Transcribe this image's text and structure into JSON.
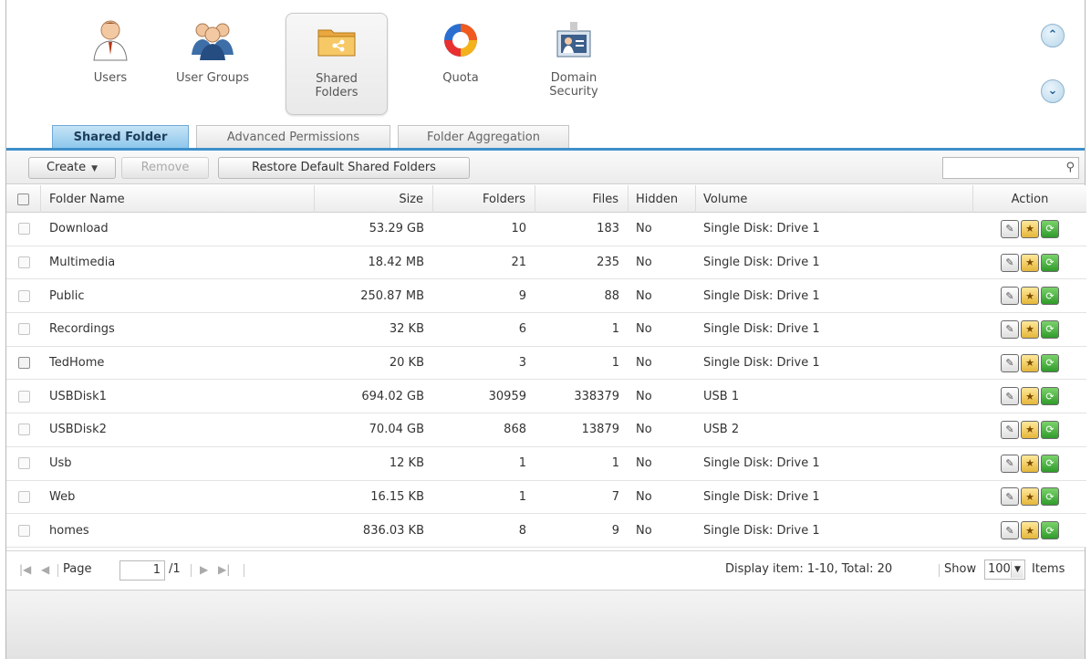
{
  "apps": [
    {
      "label": "Users",
      "icon": "user-icon"
    },
    {
      "label": "User Groups",
      "icon": "user-groups-icon"
    },
    {
      "label": "Shared\nFolders",
      "icon": "shared-folder-icon",
      "active": true
    },
    {
      "label": "Quota",
      "icon": "quota-pie-icon"
    },
    {
      "label": "Domain\nSecurity",
      "icon": "domain-security-icon"
    }
  ],
  "nav": {
    "scroll_up_icon": "chevron-up-icon",
    "scroll_down_icon": "chevron-down-icon"
  },
  "tabs": [
    {
      "label": "Shared Folder",
      "active": true
    },
    {
      "label": "Advanced Permissions"
    },
    {
      "label": "Folder Aggregation"
    }
  ],
  "toolbar": {
    "create_label": "Create",
    "remove_label": "Remove",
    "restore_label": "Restore Default Shared Folders",
    "search_value": ""
  },
  "table": {
    "columns": [
      "Folder Name",
      "Size",
      "Folders",
      "Files",
      "Hidden",
      "Volume",
      "Action"
    ],
    "rows": [
      {
        "name": "Download",
        "size": "53.29 GB",
        "folders": "10",
        "files": "183",
        "hidden": "No",
        "volume": "Single Disk: Drive 1",
        "checked_style": "light"
      },
      {
        "name": "Multimedia",
        "size": "18.42 MB",
        "folders": "21",
        "files": "235",
        "hidden": "No",
        "volume": "Single Disk: Drive 1",
        "checked_style": "light"
      },
      {
        "name": "Public",
        "size": "250.87 MB",
        "folders": "9",
        "files": "88",
        "hidden": "No",
        "volume": "Single Disk: Drive 1",
        "checked_style": "light"
      },
      {
        "name": "Recordings",
        "size": "32 KB",
        "folders": "6",
        "files": "1",
        "hidden": "No",
        "volume": "Single Disk: Drive 1",
        "checked_style": "light"
      },
      {
        "name": "TedHome",
        "size": "20 KB",
        "folders": "3",
        "files": "1",
        "hidden": "No",
        "volume": "Single Disk: Drive 1",
        "checked_style": "dark"
      },
      {
        "name": "USBDisk1",
        "size": "694.02 GB",
        "folders": "30959",
        "files": "338379",
        "hidden": "No",
        "volume": "USB 1",
        "checked_style": "light"
      },
      {
        "name": "USBDisk2",
        "size": "70.04 GB",
        "folders": "868",
        "files": "13879",
        "hidden": "No",
        "volume": "USB 2",
        "checked_style": "light"
      },
      {
        "name": "Usb",
        "size": "12 KB",
        "folders": "1",
        "files": "1",
        "hidden": "No",
        "volume": "Single Disk: Drive 1",
        "checked_style": "light"
      },
      {
        "name": "Web",
        "size": "16.15 KB",
        "folders": "1",
        "files": "7",
        "hidden": "No",
        "volume": "Single Disk: Drive 1",
        "checked_style": "light"
      },
      {
        "name": "homes",
        "size": "836.03 KB",
        "folders": "8",
        "files": "9",
        "hidden": "No",
        "volume": "Single Disk: Drive 1",
        "checked_style": "light"
      }
    ],
    "action_icons": [
      "edit-icon",
      "permission-icon",
      "refresh-icon"
    ]
  },
  "pager": {
    "page_label": "Page",
    "page_value": "1",
    "page_total": "/1",
    "display_text": "Display item: 1-10, Total: 20",
    "show_label": "Show",
    "show_value": "100",
    "items_label": "Items"
  }
}
